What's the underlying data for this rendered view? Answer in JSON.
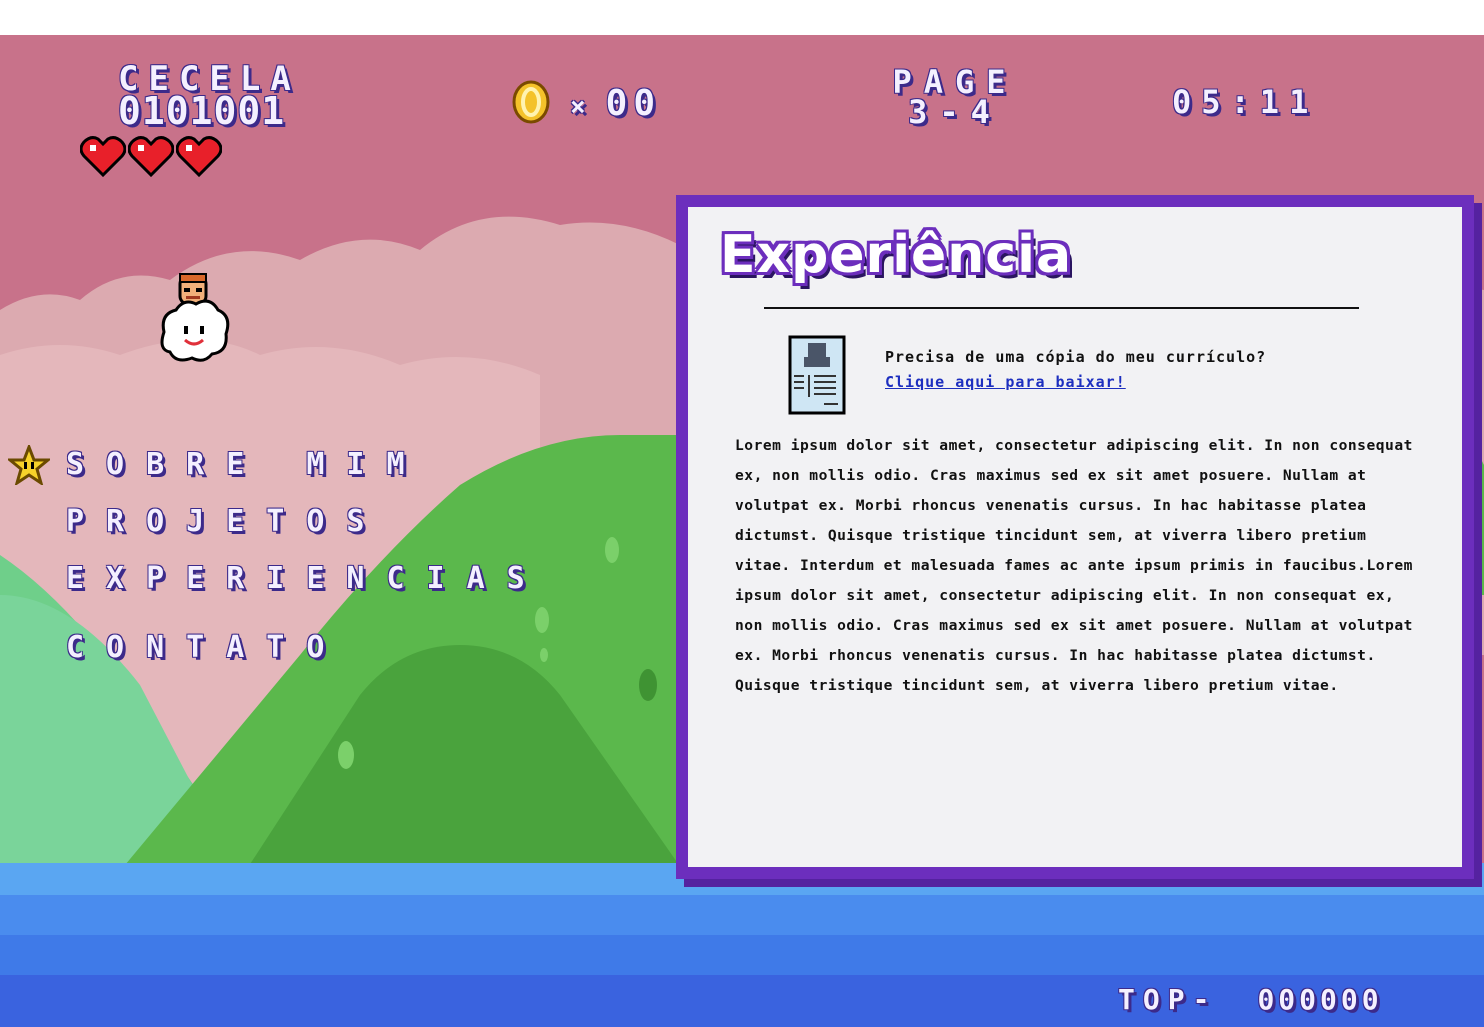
{
  "hud": {
    "player_name": "CECELA",
    "player_score": "0101001",
    "lives": 3,
    "coin_x": "×",
    "coin_count": "00",
    "page_word": "PAGE",
    "page_number": "3-4",
    "time": "05:11",
    "top_label": "TOP-",
    "top_score": "000000"
  },
  "menu": {
    "items": [
      {
        "label": "SOBRE MIM"
      },
      {
        "label": "PROJETOS"
      },
      {
        "label": "EXPERIENCIAS"
      },
      {
        "label": "CONTATO"
      }
    ],
    "selected_index": 0
  },
  "panel": {
    "title": "Experiência",
    "cv_question": "Precisa de uma cópia do meu currículo?",
    "cv_link": "Clique aqui para baixar!",
    "body": "Lorem ipsum dolor sit amet, consectetur adipiscing elit. In non consequat ex, non mollis odio. Cras maximus sed ex sit amet posuere. Nullam at volutpat ex. Morbi rhoncus venenatis cursus. In hac habitasse platea dictumst. Quisque tristique tincidunt sem, at viverra libero pretium vitae. Interdum et malesuada fames ac ante ipsum primis in faucibus.Lorem ipsum dolor sit amet, consectetur adipiscing elit. In non consequat ex, non mollis odio. Cras maximus sed ex sit amet posuere. Nullam at volutpat ex. Morbi rhoncus venenatis cursus. In hac habitasse platea dictumst. Quisque tristique tincidunt sem, at viverra libero pretium vitae."
  },
  "colors": {
    "sky": "#c8728a",
    "panel_border": "#6c2ebd",
    "hill_green": "#5bb84c",
    "water": "#3f7ae8"
  },
  "icons": [
    "heart-icon",
    "coin-icon",
    "star-icon",
    "cloud-character",
    "resume-icon"
  ]
}
